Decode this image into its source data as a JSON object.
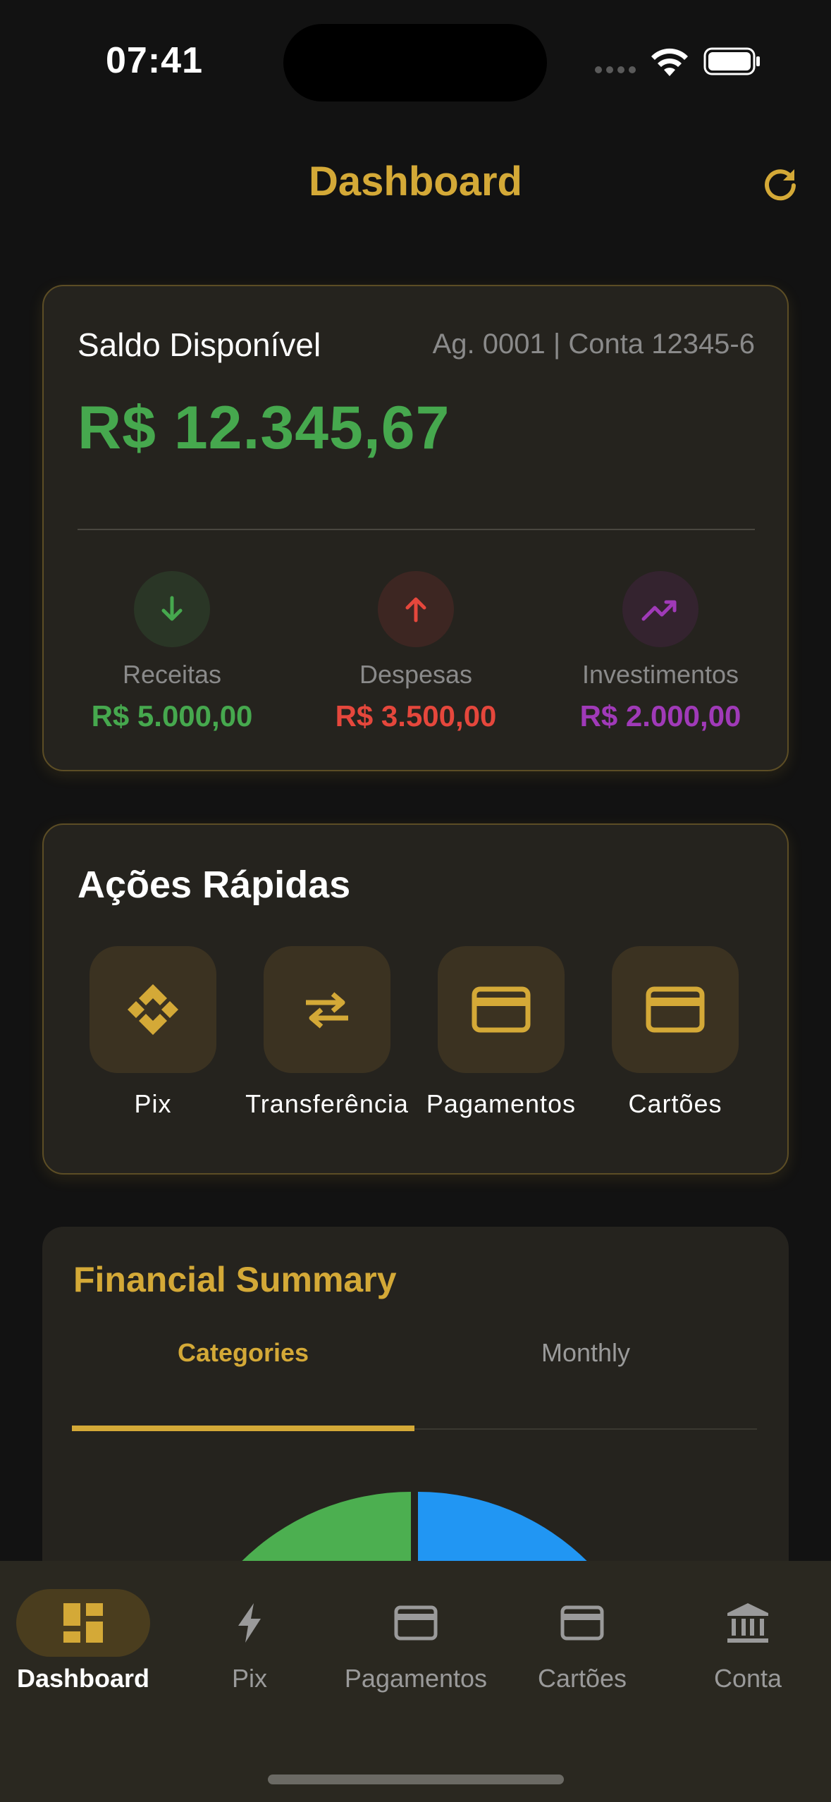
{
  "status_bar": {
    "time": "07:41"
  },
  "header": {
    "title": "Dashboard",
    "refresh_icon": "refresh-icon"
  },
  "balance": {
    "label": "Saldo Disponível",
    "account": "Ag. 0001 | Conta 12345-6",
    "amount": "R$ 12.345,67",
    "stats": [
      {
        "label": "Receitas",
        "value": "R$ 5.000,00",
        "icon": "arrow-down-icon",
        "color": "#46a84e"
      },
      {
        "label": "Despesas",
        "value": "R$ 3.500,00",
        "icon": "arrow-up-icon",
        "color": "#e5473c"
      },
      {
        "label": "Investimentos",
        "value": "R$ 2.000,00",
        "icon": "trending-up-icon",
        "color": "#a03ab8"
      }
    ]
  },
  "quick_actions": {
    "title": "Ações Rápidas",
    "items": [
      {
        "label": "Pix",
        "icon": "pix-icon"
      },
      {
        "label": "Transferência",
        "icon": "transfer-icon"
      },
      {
        "label": "Pagamentos",
        "icon": "card-icon"
      },
      {
        "label": "Cartões",
        "icon": "card-icon"
      }
    ]
  },
  "summary": {
    "title": "Financial Summary",
    "tabs": [
      {
        "label": "Categories",
        "active": true
      },
      {
        "label": "Monthly",
        "active": false
      }
    ],
    "pie_colors": [
      "#4caf50",
      "#2196f3"
    ]
  },
  "bottom_nav": {
    "items": [
      {
        "label": "Dashboard",
        "icon": "dashboard-icon",
        "active": true
      },
      {
        "label": "Pix",
        "icon": "bolt-icon",
        "active": false
      },
      {
        "label": "Pagamentos",
        "icon": "card-icon",
        "active": false
      },
      {
        "label": "Cartões",
        "icon": "card-icon",
        "active": false
      },
      {
        "label": "Conta",
        "icon": "bank-icon",
        "active": false
      }
    ]
  },
  "colors": {
    "accent": "#d4a937",
    "income": "#46a84e",
    "expense": "#e5473c",
    "investment": "#a03ab8"
  }
}
